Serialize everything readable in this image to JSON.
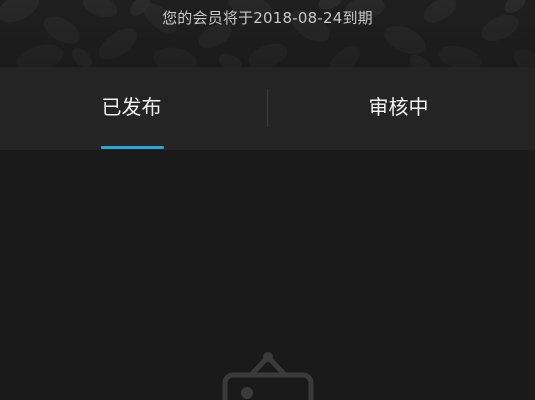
{
  "header": {
    "membership_notice": "您的会员将于2018-08-24到期"
  },
  "tabs": [
    {
      "label": "已发布",
      "active": true
    },
    {
      "label": "审核中",
      "active": false
    }
  ],
  "colors": {
    "accent": "#29a8d8",
    "background": "#1a1a1a",
    "tabbar": "#242424"
  },
  "empty_state": {
    "icon": "picture-frame-icon"
  }
}
